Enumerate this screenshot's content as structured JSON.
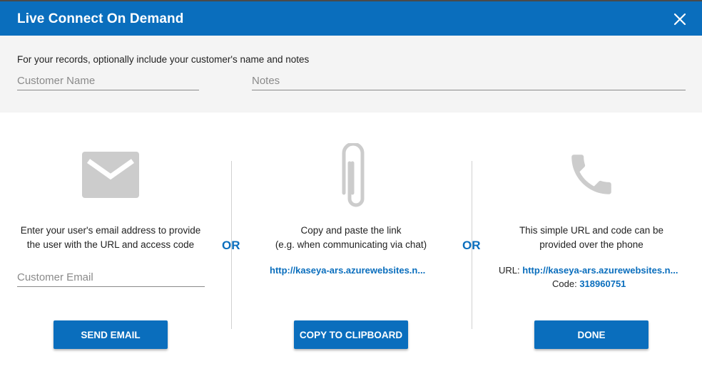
{
  "dialog": {
    "title": "Live Connect On Demand"
  },
  "records": {
    "instruction": "For your records, optionally include your customer's name and notes",
    "customer_name_placeholder": "Customer Name",
    "notes_placeholder": "Notes"
  },
  "separator": {
    "or_label": "OR"
  },
  "email": {
    "icon": "envelope-icon",
    "description_line1": "Enter your user's email address to provide",
    "description_line2": "the user with the URL and access code",
    "email_placeholder": "Customer Email",
    "button_label": "SEND EMAIL"
  },
  "clipboard": {
    "icon": "paperclip-icon",
    "description_line1": "Copy and paste the link",
    "description_line2": "(e.g. when communicating via chat)",
    "link_text": "http://kaseya-ars.azurewebsites.n...",
    "button_label": "COPY TO CLIPBOARD"
  },
  "phone": {
    "icon": "phone-icon",
    "description_line1": "This simple URL and code can be",
    "description_line2": "provided over the phone",
    "url_label": "URL:",
    "url_value": "http://kaseya-ars.azurewebsites.n...",
    "code_label": "Code:",
    "code_value": "318960751",
    "button_label": "DONE"
  },
  "colors": {
    "accent": "#0a6ebd",
    "icon_gray": "#cccccc",
    "section_bg": "#f4f4f4"
  }
}
